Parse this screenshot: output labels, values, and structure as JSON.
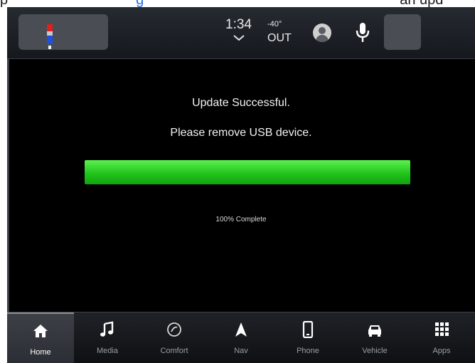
{
  "caption": {
    "prefix": "p",
    "suffix": "an upd",
    "link_text": "g"
  },
  "status_bar": {
    "time": "1:34",
    "outside_temp": "-40°",
    "out_label": "OUT",
    "icons": [
      "thermostat-icon",
      "chevron-down-icon",
      "profile-icon",
      "microphone-icon"
    ]
  },
  "update": {
    "message": "Update Successful.",
    "instruction": "Please remove USB device.",
    "progress_percent": 100,
    "progress_text": "100% Complete"
  },
  "nav": {
    "items": [
      {
        "label": "Home",
        "icon": "home-icon",
        "active": true
      },
      {
        "label": "Media",
        "icon": "music-note-icon",
        "active": false
      },
      {
        "label": "Comfort",
        "icon": "comfort-icon",
        "active": false
      },
      {
        "label": "Nav",
        "icon": "navigation-arrow-icon",
        "active": false
      },
      {
        "label": "Phone",
        "icon": "phone-icon",
        "active": false
      },
      {
        "label": "Vehicle",
        "icon": "vehicle-icon",
        "active": false
      },
      {
        "label": "Apps",
        "icon": "apps-grid-icon",
        "active": false
      }
    ]
  },
  "colors": {
    "progress_green": "#22c51c",
    "background": "#000000",
    "thermo_red": "#e02020",
    "thermo_blue": "#2050e0"
  }
}
